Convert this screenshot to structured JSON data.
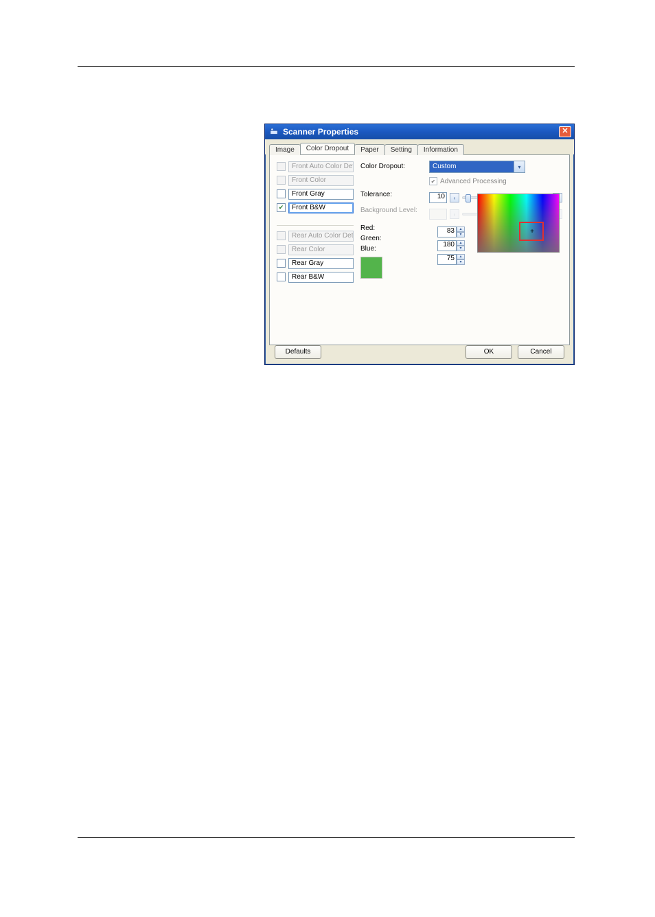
{
  "window": {
    "title": "Scanner Properties"
  },
  "tabs": [
    "Image",
    "Color Dropout",
    "Paper",
    "Setting",
    "Information"
  ],
  "activeTab": 1,
  "leftItems": [
    {
      "label": "Front Auto Color Detection",
      "checked": false,
      "disabled": true
    },
    {
      "label": "Front Color",
      "checked": false,
      "disabled": true
    },
    {
      "label": "Front Gray",
      "checked": false,
      "disabled": false
    },
    {
      "label": "Front B&W",
      "checked": true,
      "disabled": false,
      "highlight": true
    }
  ],
  "leftItemsRear": [
    {
      "label": "Rear Auto Color Detection",
      "checked": false,
      "disabled": true
    },
    {
      "label": "Rear Color",
      "checked": false,
      "disabled": true
    },
    {
      "label": "Rear Gray",
      "checked": false,
      "disabled": false
    },
    {
      "label": "Rear B&W",
      "checked": false,
      "disabled": false
    }
  ],
  "labels": {
    "colorDropout": "Color Dropout:",
    "tolerance": "Tolerance:",
    "backgroundLevel": "Background Level:",
    "red": "Red:",
    "green": "Green:",
    "blue": "Blue:",
    "advanced": "Advanced Processing"
  },
  "values": {
    "dropoutMode": "Custom",
    "tolerance": "10",
    "red": "83",
    "green": "180",
    "blue": "75"
  },
  "swatchColor": "#53b44b",
  "buttons": {
    "defaults": "Defaults",
    "ok": "OK",
    "cancel": "Cancel"
  }
}
